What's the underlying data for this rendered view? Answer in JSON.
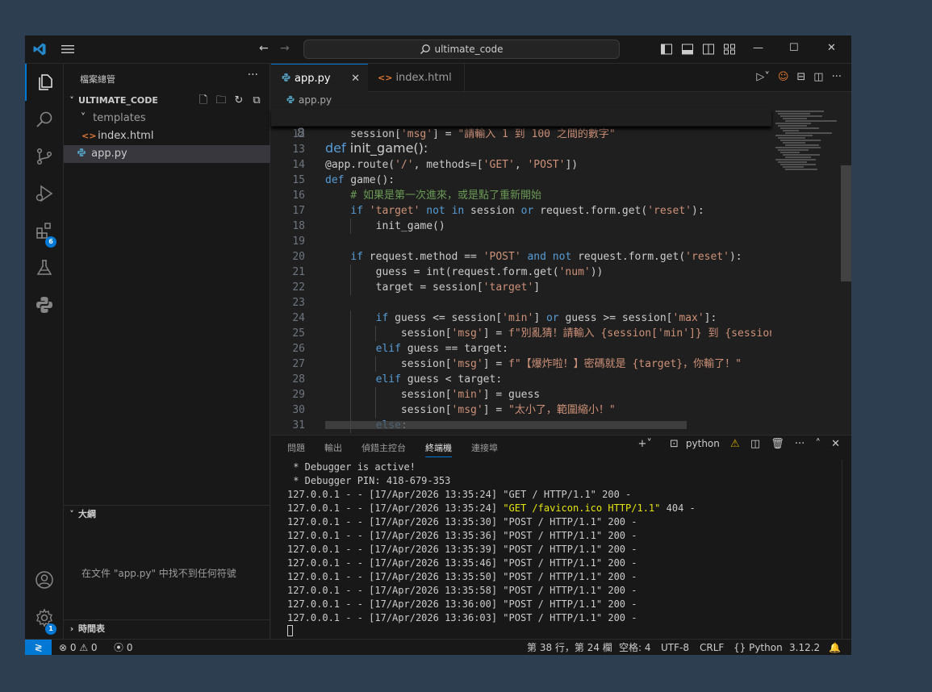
{
  "titlebar": {
    "search_text": "ultimate_code",
    "back": "←",
    "forward": "→",
    "minimize": "—",
    "maximize": "☐",
    "close": "✕"
  },
  "activity": {
    "extensions_badge": "6",
    "settings_badge": "1"
  },
  "sidebar": {
    "header": "檔案總管",
    "more": "···",
    "folder": "ULTIMATE_CODE",
    "items": [
      {
        "label": "templates",
        "icon": "˅"
      },
      {
        "label": "index.html",
        "icon": "<>"
      },
      {
        "label": "app.py",
        "icon": "py"
      }
    ],
    "outline_title": "大綱",
    "outline_msg": "在文件 \"app.py\" 中找不到任何符號",
    "timeline_title": "時間表"
  },
  "editor": {
    "tabs": [
      {
        "label": "app.py"
      },
      {
        "label": "index.html"
      }
    ],
    "breadcrumb": "app.py",
    "sticky": {
      "num": "8",
      "text": "def init_game():"
    },
    "lines": [
      {
        "num": "12",
        "text": "    session['msg'] = \"請輸入 1 到 100 之間的數字\""
      },
      {
        "num": "13",
        "text": ""
      },
      {
        "num": "14",
        "text": "@app.route('/', methods=['GET', 'POST'])"
      },
      {
        "num": "15",
        "text": "def game():"
      },
      {
        "num": "16",
        "text": "    # 如果是第一次進來，或是點了重新開始"
      },
      {
        "num": "17",
        "text": "    if 'target' not in session or request.form.get('reset'):"
      },
      {
        "num": "18",
        "text": "        init_game()"
      },
      {
        "num": "19",
        "text": ""
      },
      {
        "num": "20",
        "text": "    if request.method == 'POST' and not request.form.get('reset'):"
      },
      {
        "num": "21",
        "text": "        guess = int(request.form.get('num'))"
      },
      {
        "num": "22",
        "text": "        target = session['target']"
      },
      {
        "num": "23",
        "text": ""
      },
      {
        "num": "24",
        "text": "        if guess <= session['min'] or guess >= session['max']:"
      },
      {
        "num": "25",
        "text": "            session['msg'] = f\"別亂猜！請輸入 {session['min']} 到 {session"
      },
      {
        "num": "26",
        "text": "        elif guess == target:"
      },
      {
        "num": "27",
        "text": "            session['msg'] = f\"【爆炸啦！】密碼就是 {target}，你輸了！\""
      },
      {
        "num": "28",
        "text": "        elif guess < target:"
      },
      {
        "num": "29",
        "text": "            session['min'] = guess"
      },
      {
        "num": "30",
        "text": "            session['msg'] = \"太小了，範圍縮小！\""
      },
      {
        "num": "31",
        "text": "        else:"
      }
    ]
  },
  "panel": {
    "tabs": [
      "問題",
      "輸出",
      "偵錯主控台",
      "終端機",
      "連接埠"
    ],
    "terminal_name": "python",
    "terminal_lines": [
      " * Debugger is active!",
      " * Debugger PIN: 418-679-353",
      "127.0.0.1 - - [17/Apr/2026 13:35:24] \"GET / HTTP/1.1\" 200 -",
      "127.0.0.1 - - [17/Apr/2026 13:35:24] \"GET /favicon.ico HTTP/1.1\" 404 -",
      "127.0.0.1 - - [17/Apr/2026 13:35:30] \"POST / HTTP/1.1\" 200 -",
      "127.0.0.1 - - [17/Apr/2026 13:35:36] \"POST / HTTP/1.1\" 200 -",
      "127.0.0.1 - - [17/Apr/2026 13:35:39] \"POST / HTTP/1.1\" 200 -",
      "127.0.0.1 - - [17/Apr/2026 13:35:46] \"POST / HTTP/1.1\" 200 -",
      "127.0.0.1 - - [17/Apr/2026 13:35:50] \"POST / HTTP/1.1\" 200 -",
      "127.0.0.1 - - [17/Apr/2026 13:35:58] \"POST / HTTP/1.1\" 200 -",
      "127.0.0.1 - - [17/Apr/2026 13:36:00] \"POST / HTTP/1.1\" 200 -",
      "127.0.0.1 - - [17/Apr/2026 13:36:03] \"POST / HTTP/1.1\" 200 -"
    ]
  },
  "status": {
    "errors": "⊗ 0",
    "warnings": "⚠ 0",
    "ports": "0",
    "position": "第 38 行，第 24 欄",
    "spaces": "空格: 4",
    "encoding": "UTF-8",
    "eol": "CRLF",
    "language": "{} Python",
    "version": "3.12.2"
  },
  "colors": {
    "accent": "#0078d4",
    "editor_bg": "#1f1f1f",
    "chrome_bg": "#181818",
    "desktop_bg": "#2c3e50"
  }
}
